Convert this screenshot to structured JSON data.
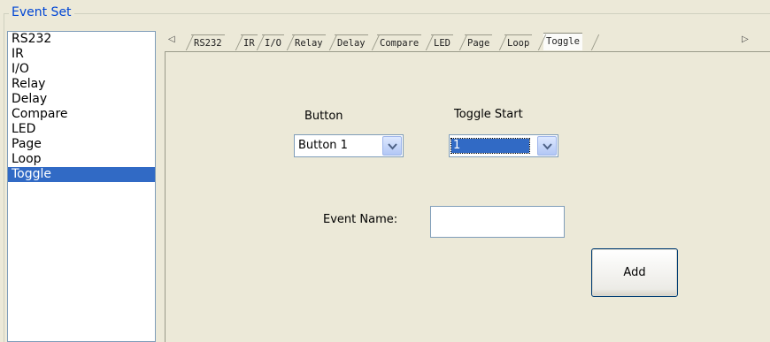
{
  "groupbox": {
    "title": "Event Set"
  },
  "list": {
    "items": [
      "RS232",
      "IR",
      "I/O",
      "Relay",
      "Delay",
      "Compare",
      "LED",
      "Page",
      "Loop",
      "Toggle"
    ],
    "selected": "Toggle"
  },
  "tabs": {
    "labels": [
      "RS232",
      "IR",
      "I/O",
      "Relay",
      "Delay",
      "Compare",
      "LED",
      "Page",
      "Loop",
      "Toggle"
    ],
    "active": "Toggle",
    "prev_arrow": "◁",
    "next_arrow": "▷"
  },
  "form": {
    "button_label": "Button",
    "button_value": "Button 1",
    "toggle_start_label": "Toggle Start",
    "toggle_start_value": "1",
    "event_name_label": "Event Name:",
    "event_name_value": "",
    "add_label": "Add"
  },
  "colors": {
    "title_blue": "#0046d5",
    "selection": "#316ac5",
    "background": "#ece9d8"
  }
}
